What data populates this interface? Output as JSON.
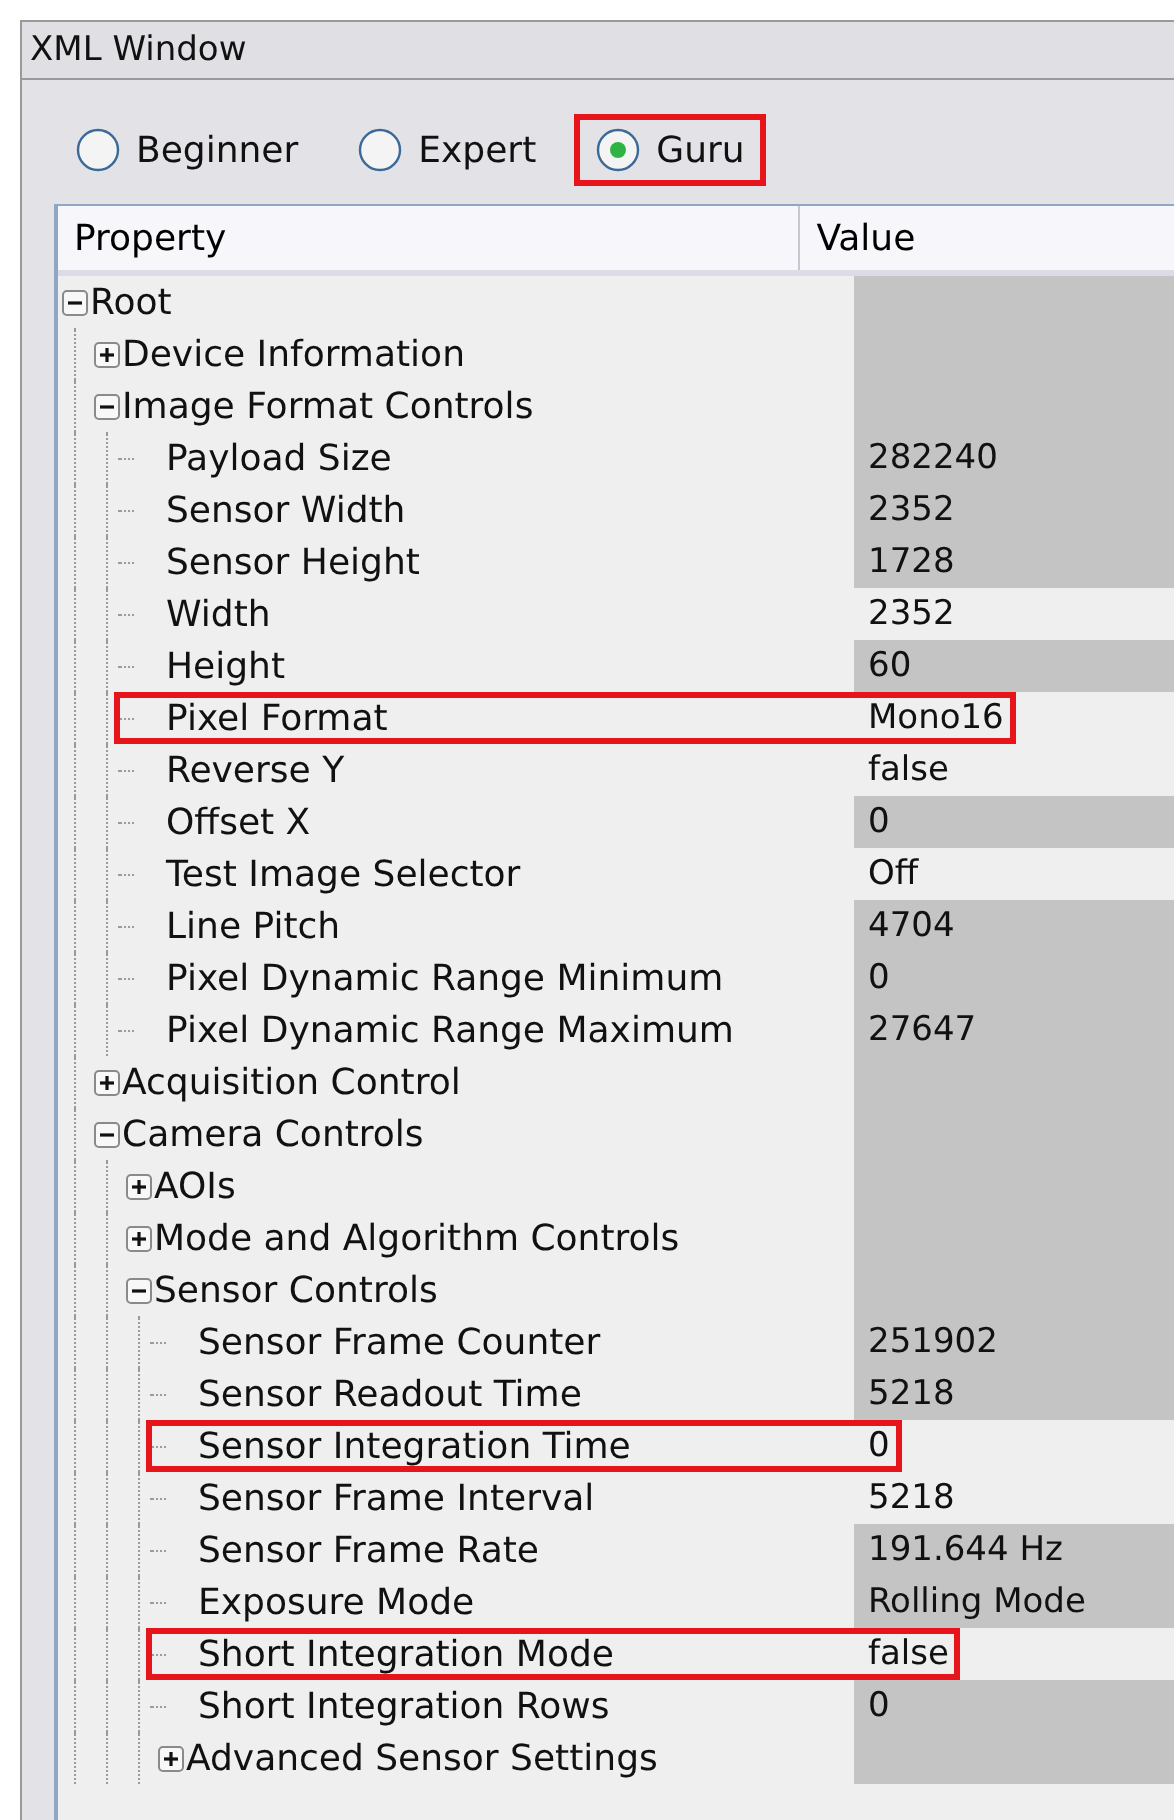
{
  "window": {
    "title": "XML Window"
  },
  "mode_options": [
    {
      "label": "Beginner",
      "selected": false,
      "highlighted": false
    },
    {
      "label": "Expert",
      "selected": false,
      "highlighted": false
    },
    {
      "label": "Guru",
      "selected": true,
      "highlighted": true
    }
  ],
  "columns": [
    "Property",
    "Value"
  ],
  "tree": [
    {
      "label": "Root",
      "expanded": true,
      "children": [
        {
          "label": "Device Information",
          "expanded": false
        },
        {
          "label": "Image Format Controls",
          "expanded": true,
          "children": [
            {
              "label": "Payload Size",
              "value": "282240",
              "read_only": true,
              "highlighted": false
            },
            {
              "label": "Sensor Width",
              "value": "2352",
              "read_only": true,
              "highlighted": false
            },
            {
              "label": "Sensor Height",
              "value": "1728",
              "read_only": true,
              "highlighted": false
            },
            {
              "label": "Width",
              "value": "2352",
              "read_only": false,
              "highlighted": false
            },
            {
              "label": "Height",
              "value": "60",
              "read_only": true,
              "highlighted": false
            },
            {
              "label": "Pixel Format",
              "value": "Mono16",
              "read_only": false,
              "highlighted": true
            },
            {
              "label": "Reverse Y",
              "value": "false",
              "read_only": false,
              "highlighted": false
            },
            {
              "label": "Offset X",
              "value": "0",
              "read_only": true,
              "highlighted": false
            },
            {
              "label": "Test Image Selector",
              "value": "Off",
              "read_only": false,
              "highlighted": false
            },
            {
              "label": "Line Pitch",
              "value": "4704",
              "read_only": true,
              "highlighted": false
            },
            {
              "label": "Pixel Dynamic Range Minimum",
              "value": "0",
              "read_only": true,
              "highlighted": false
            },
            {
              "label": "Pixel Dynamic Range Maximum",
              "value": "27647",
              "read_only": true,
              "highlighted": false
            }
          ]
        },
        {
          "label": "Acquisition Control",
          "expanded": false
        },
        {
          "label": "Camera Controls",
          "expanded": true,
          "children": [
            {
              "label": "AOIs",
              "expanded": false
            },
            {
              "label": "Mode and Algorithm Controls",
              "expanded": false
            },
            {
              "label": "Sensor Controls",
              "expanded": true,
              "children": [
                {
                  "label": "Sensor Frame Counter",
                  "value": "251902",
                  "read_only": true,
                  "highlighted": false
                },
                {
                  "label": "Sensor Readout Time",
                  "value": "5218",
                  "read_only": true,
                  "highlighted": false
                },
                {
                  "label": "Sensor Integration Time",
                  "value": "0",
                  "read_only": false,
                  "highlighted": true
                },
                {
                  "label": "Sensor Frame Interval",
                  "value": "5218",
                  "read_only": false,
                  "highlighted": false
                },
                {
                  "label": "Sensor Frame Rate",
                  "value": "191.644 Hz",
                  "read_only": true,
                  "highlighted": false
                },
                {
                  "label": "Exposure Mode",
                  "value": "Rolling Mode",
                  "read_only": true,
                  "highlighted": false
                },
                {
                  "label": "Short Integration Mode",
                  "value": "false",
                  "read_only": false,
                  "highlighted": true
                },
                {
                  "label": "Short Integration Rows",
                  "value": "0",
                  "read_only": true,
                  "highlighted": false
                },
                {
                  "label": "Advanced Sensor Settings",
                  "expanded": false
                }
              ]
            }
          ]
        }
      ]
    }
  ]
}
